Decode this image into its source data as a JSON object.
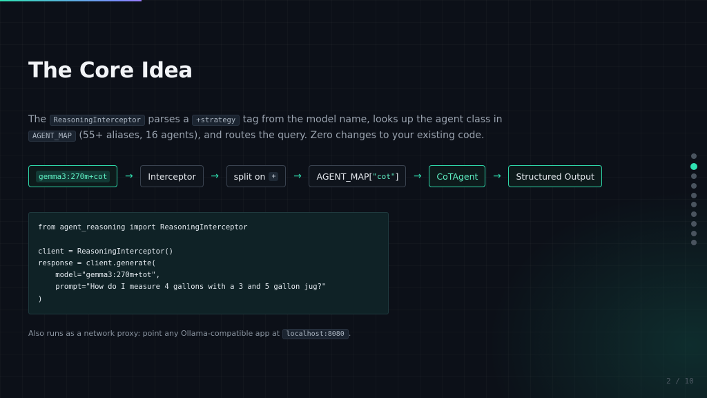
{
  "progress": {
    "fraction": 0.2,
    "accent": "#2fe3b4"
  },
  "slide": {
    "title": "The Core Idea",
    "intro": {
      "t1": "The ",
      "code1": "ReasoningInterceptor",
      "t2": " parses a ",
      "code2": "+strategy",
      "t3": " tag from the model name, looks up the agent class in ",
      "code3": "AGENT_MAP",
      "t4": " (55+ aliases, 16 agents), and routes the query. Zero changes to your existing code."
    },
    "pipeline": {
      "model": "gemma3:270m+cot",
      "interceptor": "Interceptor",
      "split_label": "split on",
      "split_char": "+",
      "map_prefix": "AGENT_MAP[",
      "map_key": "\"cot\"",
      "map_suffix": "]",
      "agent": "CoTAgent",
      "output": "Structured Output",
      "arrow": "→"
    },
    "code_lines": [
      "from agent_reasoning import ReasoningInterceptor",
      "",
      "client = ReasoningInterceptor()",
      "response = client.generate(",
      "    model=\"gemma3:270m+tot\",",
      "    prompt=\"How do I measure 4 gallons with a 3 and 5 gallon jug?\"",
      ")"
    ],
    "footnote": {
      "text": "Also runs as a network proxy: point any Ollama-compatible app at ",
      "code": "localhost:8080",
      "end": "."
    }
  },
  "navigation": {
    "dot_count": 10,
    "active_index": 1,
    "page_indicator": "2 / 10"
  }
}
